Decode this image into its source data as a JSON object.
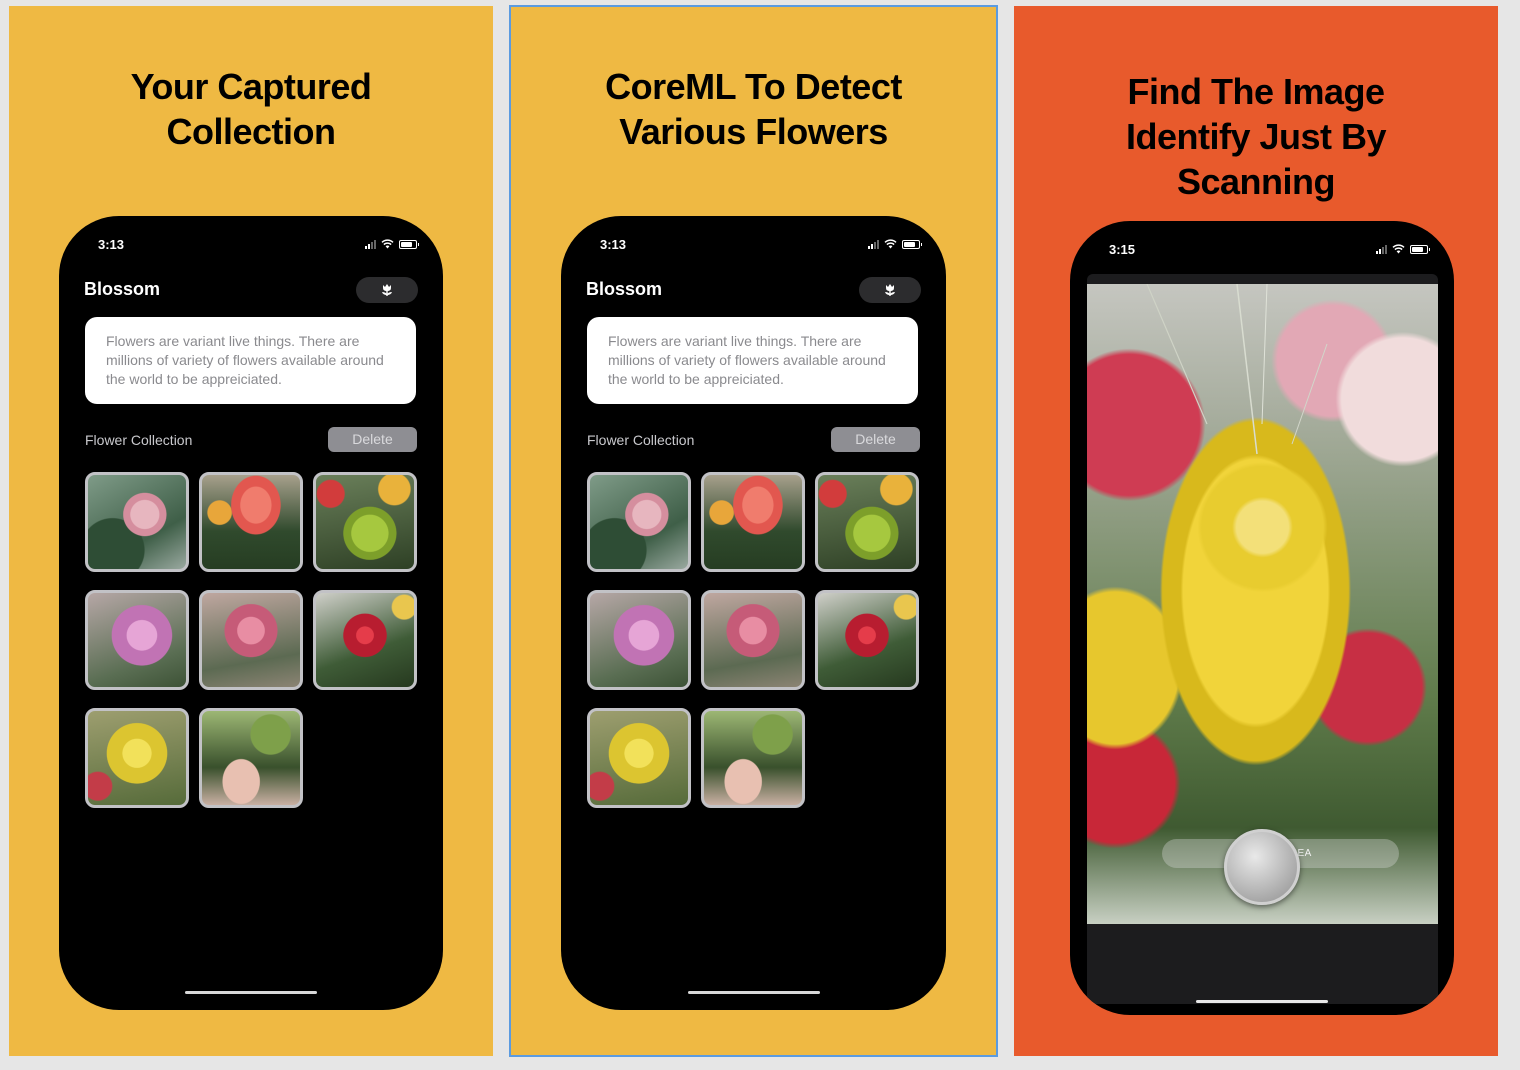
{
  "panels": [
    {
      "headline": [
        "Your Captured",
        "Collection"
      ],
      "phone": {
        "time": "3:13",
        "app_title": "Blossom",
        "description": "Flowers are variant live things. There are millions of variety of flowers available around the world to be appreiciated.",
        "section_label": "Flower Collection",
        "delete_label": "Delete"
      }
    },
    {
      "headline": [
        "CoreML To Detect",
        "Various Flowers"
      ],
      "phone": {
        "time": "3:13",
        "app_title": "Blossom",
        "description": "Flowers are variant live things. There are millions of variety of flowers available around the world to be appreiciated.",
        "section_label": "Flower Collection",
        "delete_label": "Delete"
      }
    },
    {
      "headline": [
        "Find The Image",
        "Identify Just By",
        "Scanning"
      ],
      "phone": {
        "time": "3:15",
        "scan_result": "SWEET PEA"
      }
    }
  ],
  "thumbnails": [
    "pink-rose",
    "red-carnation",
    "green-chrysanthemum",
    "lilac-rose",
    "pink-rose",
    "red-gerbera",
    "yellow-chrysanthemum",
    "hand-with-greenery"
  ],
  "colors": {
    "panel_yellow": "#efb943",
    "panel_orange": "#e85a2c",
    "phone_black": "#000000",
    "selection_outline": "#5b9be0"
  },
  "icons": [
    "tulip-icon",
    "signal-icon",
    "wifi-icon",
    "battery-icon",
    "shutter-button"
  ]
}
